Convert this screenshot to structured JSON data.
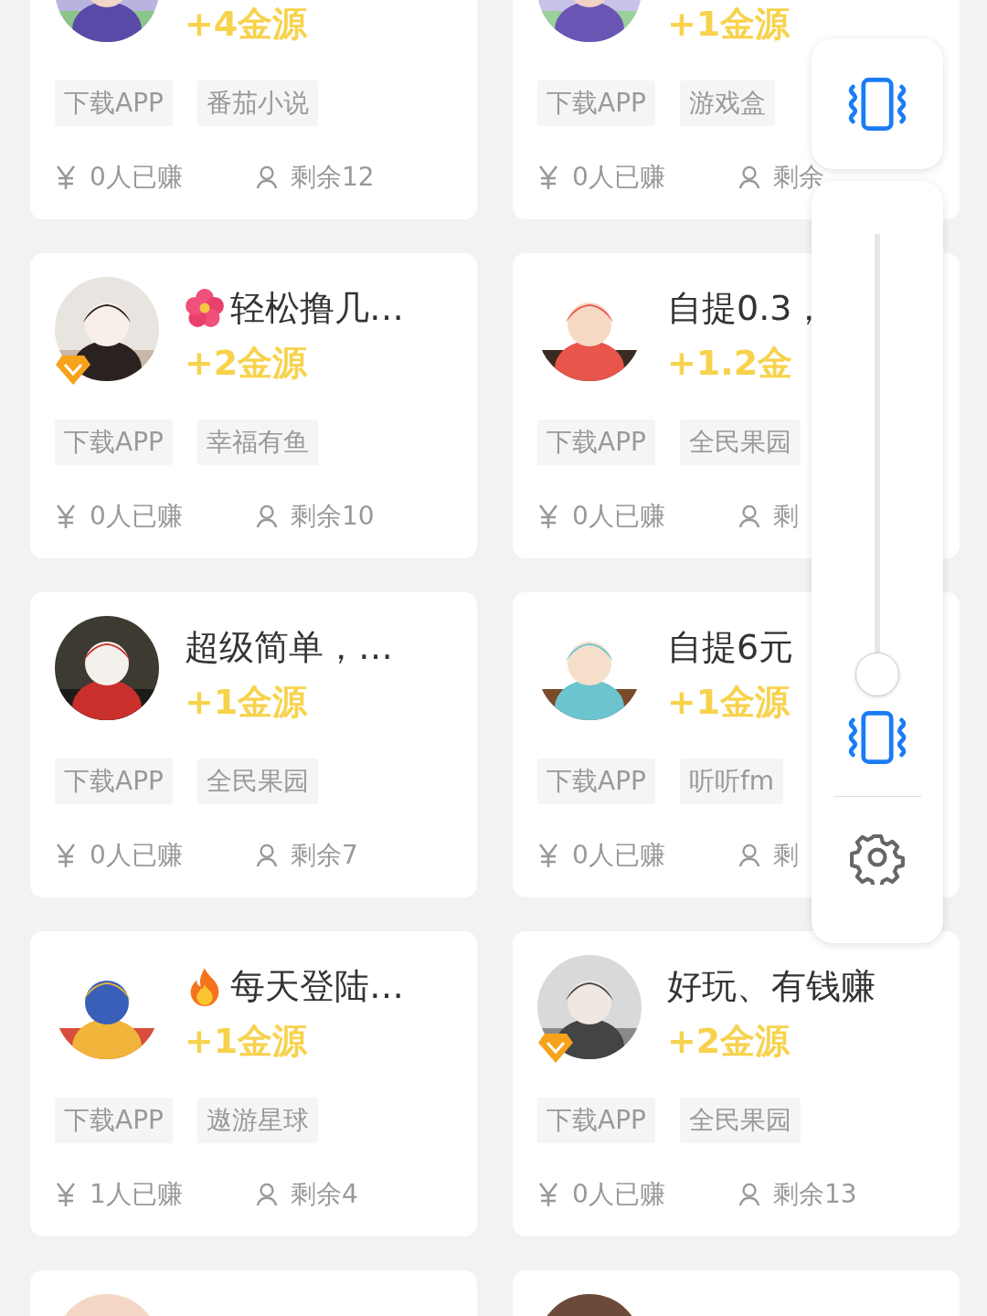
{
  "cards": [
    {
      "avatar": {
        "kind": "picture",
        "vip": false
      },
      "reward": "+4金源",
      "tags": [
        "下载APP",
        "番茄小说"
      ],
      "earned": "0人已赚",
      "remaining": "剩余12"
    },
    {
      "avatar": {
        "kind": "picture",
        "vip": false
      },
      "reward": "+1金源",
      "tags": [
        "下载APP",
        "游戏盒"
      ],
      "earned": "0人已赚",
      "remaining": "剩余"
    },
    {
      "avatar": {
        "kind": "picture",
        "vip": true
      },
      "title_icon": {
        "kind": "flower"
      },
      "title": "轻松撸几…",
      "reward": "+2金源",
      "tags": [
        "下载APP",
        "幸福有鱼"
      ],
      "earned": "0人已赚",
      "remaining": "剩余10"
    },
    {
      "avatar": {
        "kind": "picture",
        "vip": false
      },
      "title": "自提0.3，",
      "reward": "+1.2金",
      "tags": [
        "下载APP",
        "全民果园"
      ],
      "earned": "0人已赚",
      "remaining": "剩"
    },
    {
      "avatar": {
        "kind": "picture",
        "vip": false
      },
      "title": "超级简单，…",
      "reward": "+1金源",
      "tags": [
        "下载APP",
        "全民果园"
      ],
      "earned": "0人已赚",
      "remaining": "剩余7"
    },
    {
      "avatar": {
        "kind": "picture",
        "vip": false
      },
      "title": "自提6元",
      "reward": "+1金源",
      "tags": [
        "下载APP",
        "听听fm"
      ],
      "earned": "0人已赚",
      "remaining": "剩"
    },
    {
      "avatar": {
        "kind": "picture",
        "vip": false
      },
      "title_icon": {
        "kind": "fire"
      },
      "title": "每天登陆…",
      "reward": "+1金源",
      "tags": [
        "下载APP",
        "遨游星球"
      ],
      "earned": "1人已赚",
      "remaining": "剩余4"
    },
    {
      "avatar": {
        "kind": "picture",
        "vip": true
      },
      "title": "好玩、有钱赚",
      "reward": "+2金源",
      "tags": [
        "下载APP",
        "全民果园"
      ],
      "earned": "0人已赚",
      "remaining": "剩余13"
    },
    {
      "avatar": {
        "kind": "picture",
        "vip": false
      }
    },
    {
      "avatar": {
        "kind": "picture",
        "vip": false
      }
    }
  ],
  "volume_panel": {
    "vibrate_on": true,
    "level": 0
  }
}
